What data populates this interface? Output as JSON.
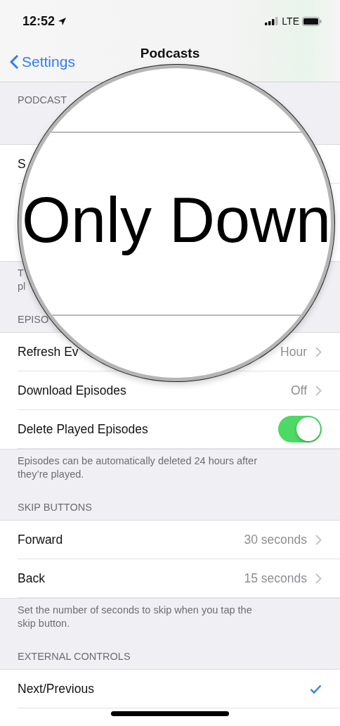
{
  "status_bar": {
    "time": "12:52",
    "network": "LTE"
  },
  "nav_bar": {
    "back": "Settings",
    "title": "Podcasts"
  },
  "sections": [
    {
      "header": "PODCAST",
      "rows": [
        {
          "kind": "plain",
          "label": "S"
        }
      ],
      "footer_lines": [
        "T",
        "pl"
      ]
    },
    {
      "header": "EPISO",
      "rows": [
        {
          "kind": "value",
          "label": "Refresh Ev",
          "value": "Hour"
        },
        {
          "kind": "value",
          "label": "Download Episodes",
          "value": "Off"
        },
        {
          "kind": "switch",
          "label": "Delete Played Episodes",
          "on": true
        }
      ],
      "footer_lines": [
        "Episodes can be automatically deleted 24 hours after",
        "they’re played."
      ]
    },
    {
      "header": "SKIP BUTTONS",
      "rows": [
        {
          "kind": "value",
          "label": "Forward",
          "value": "30 seconds"
        },
        {
          "kind": "value",
          "label": "Back",
          "value": "15 seconds"
        }
      ],
      "footer_lines": [
        "Set the number of seconds to skip when you tap the",
        "skip button."
      ]
    },
    {
      "header": "EXTERNAL CONTROLS",
      "rows": [
        {
          "kind": "check",
          "label": "Next/Previous",
          "selected": true
        }
      ]
    }
  ],
  "magnifier": {
    "text": "Only Down"
  }
}
